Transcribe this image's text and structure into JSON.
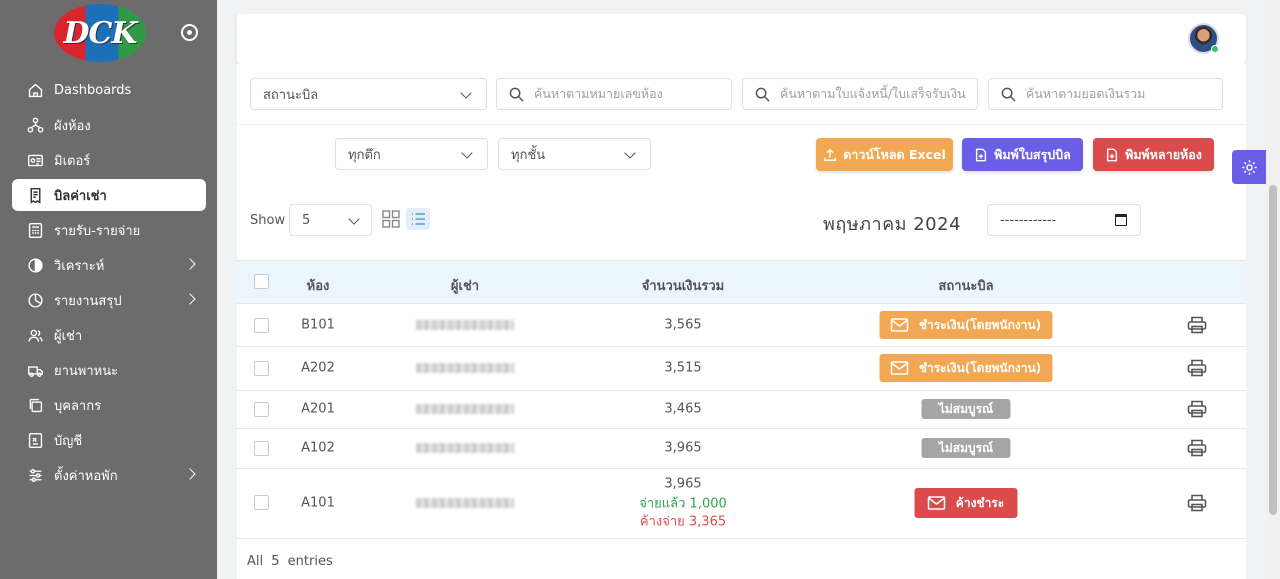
{
  "brand": {
    "logo_text": "DCK"
  },
  "sidebar": {
    "items": [
      {
        "label": "Dashboards",
        "icon": "home-icon"
      },
      {
        "label": "ผังห้อง",
        "icon": "sitemap-icon"
      },
      {
        "label": "มิเตอร์",
        "icon": "meter-icon"
      },
      {
        "label": "บิลค่าเช่า",
        "icon": "bill-icon"
      },
      {
        "label": "รายรับ-รายจ่าย",
        "icon": "calculator-icon"
      },
      {
        "label": "วิเคราะห์",
        "icon": "chart-circle-icon"
      },
      {
        "label": "รายงานสรุป",
        "icon": "pie-chart-icon"
      },
      {
        "label": "ผู้เช่า",
        "icon": "users-icon"
      },
      {
        "label": "ยานพาหนะ",
        "icon": "truck-icon"
      },
      {
        "label": "บุคลากร",
        "icon": "copy-icon"
      },
      {
        "label": "บัญชี",
        "icon": "ledger-icon"
      },
      {
        "label": "ตั้งค่าหอพัก",
        "icon": "sliders-icon"
      }
    ]
  },
  "filters": {
    "status_select": "สถานะบิล",
    "search_room_placeholder": "ค้นหาตามหมายเลขห้อง",
    "search_invoice_placeholder": "ค้นหาตามใบแจ้งหนี้/ใบเสร็จรับเงิน",
    "search_amount_placeholder": "ค้นหาตามยอดเงินรวม",
    "building_select": "ทุกตึก",
    "floor_select": "ทุกชั้น"
  },
  "actions": {
    "download_excel": "ดาวน์โหลด Excel",
    "print_summary": "พิมพ์ใบสรุปบิล",
    "print_multiple": "พิมพ์หลายห้อง"
  },
  "toolbar": {
    "show_label": "Show",
    "page_size": "5",
    "month_label": "พฤษภาคม 2024",
    "date_value": "------------"
  },
  "table": {
    "headers": {
      "room": "ห้อง",
      "tenant": "ผู้เช่า",
      "total": "จำนวนเงินรวม",
      "status": "สถานะบิล"
    },
    "rows": [
      {
        "room": "B101",
        "total": "3,565",
        "status": "ชำระเงิน(โดยพนักงาน)"
      },
      {
        "room": "A202",
        "total": "3,515",
        "status": "ชำระเงิน(โดยพนักงาน)"
      },
      {
        "room": "A201",
        "total": "3,465",
        "status": "ไม่สมบูรณ์"
      },
      {
        "room": "A102",
        "total": "3,965",
        "status": "ไม่สมบูรณ์"
      },
      {
        "room": "A101",
        "total": "3,965",
        "paid": "จ่ายแล้ว 1,000",
        "owed": "ค้างจ่าย 3,365",
        "status": "ค้างชำระ"
      }
    ]
  },
  "footer": {
    "entries": "All 5 entries"
  },
  "colors": {
    "paid_staff": "#f2a852",
    "incomplete": "#a6a6a6",
    "overdue": "#dc4b4b",
    "excel": "#f2a852",
    "summary": "#6a5de6",
    "multi": "#dc4b4b",
    "sidebar_bg": "#6c6c6c"
  }
}
